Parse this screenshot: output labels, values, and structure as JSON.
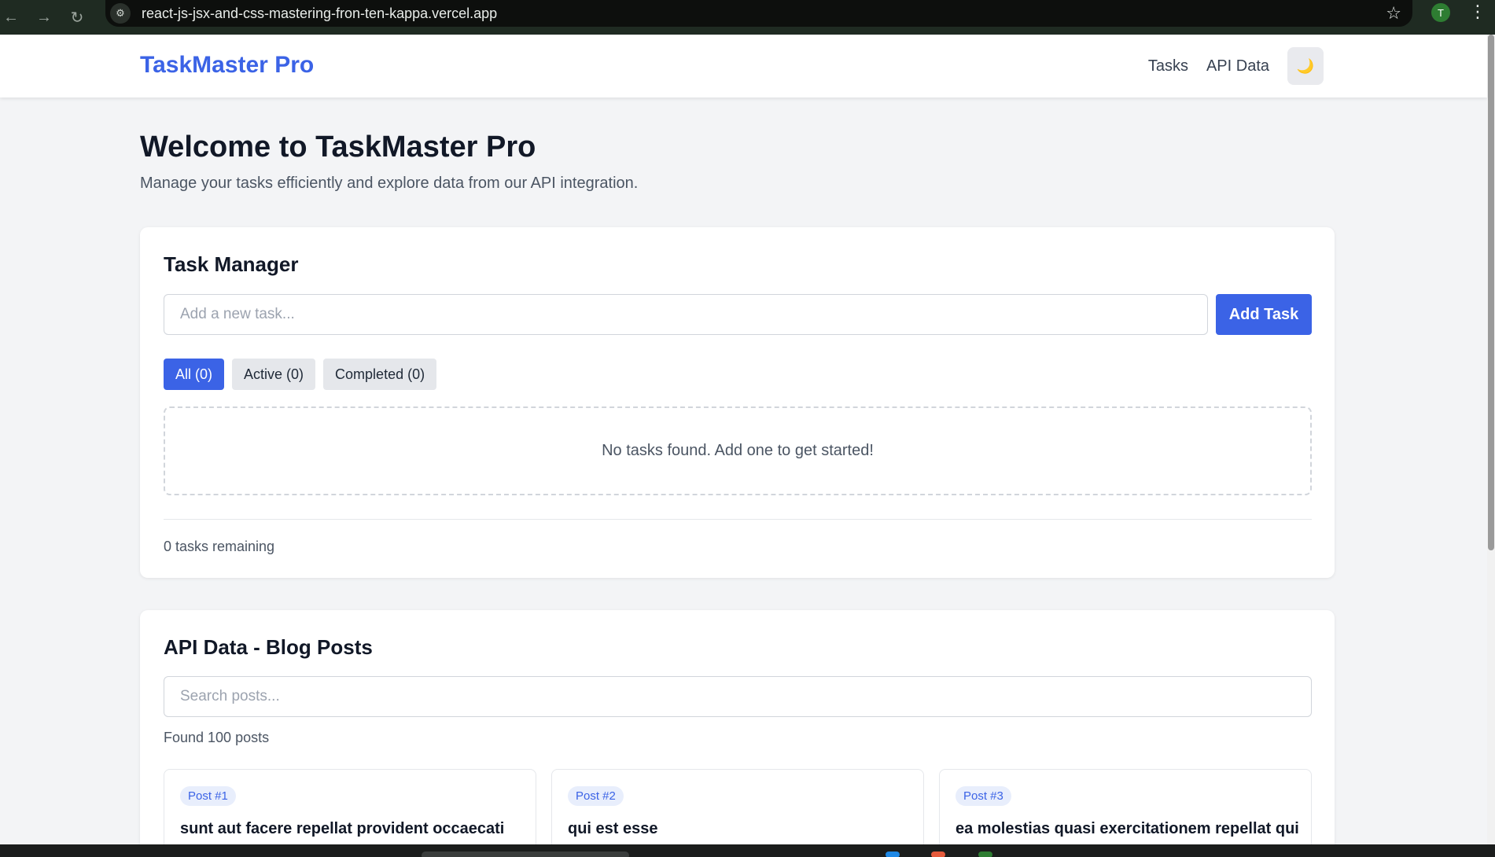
{
  "browser": {
    "url": "react-js-jsx-and-css-mastering-fron-ten-kappa.vercel.app",
    "profile_initial": "T"
  },
  "header": {
    "brand": "TaskMaster Pro",
    "nav": [
      "Tasks",
      "API Data"
    ],
    "theme_icon": "🌙"
  },
  "intro": {
    "title": "Welcome to TaskMaster Pro",
    "subtitle": "Manage your tasks efficiently and explore data from our API integration."
  },
  "task_manager": {
    "title": "Task Manager",
    "input_placeholder": "Add a new task...",
    "add_button": "Add Task",
    "filters": [
      {
        "label": "All (0)",
        "active": true
      },
      {
        "label": "Active (0)",
        "active": false
      },
      {
        "label": "Completed (0)",
        "active": false
      }
    ],
    "empty_message": "No tasks found. Add one to get started!",
    "remaining": "0 tasks remaining"
  },
  "api_data": {
    "title": "API Data - Blog Posts",
    "search_placeholder": "Search posts...",
    "found_text": "Found 100 posts",
    "posts": [
      {
        "badge": "Post #1",
        "title": "sunt aut facere repellat provident occaecati"
      },
      {
        "badge": "Post #2",
        "title": "qui est esse"
      },
      {
        "badge": "Post #3",
        "title": "ea molestias quasi exercitationem repellat qui"
      }
    ]
  },
  "colors": {
    "accent": "#3b63e6",
    "background": "#f3f4f6",
    "chrome": "#1f2b22"
  }
}
